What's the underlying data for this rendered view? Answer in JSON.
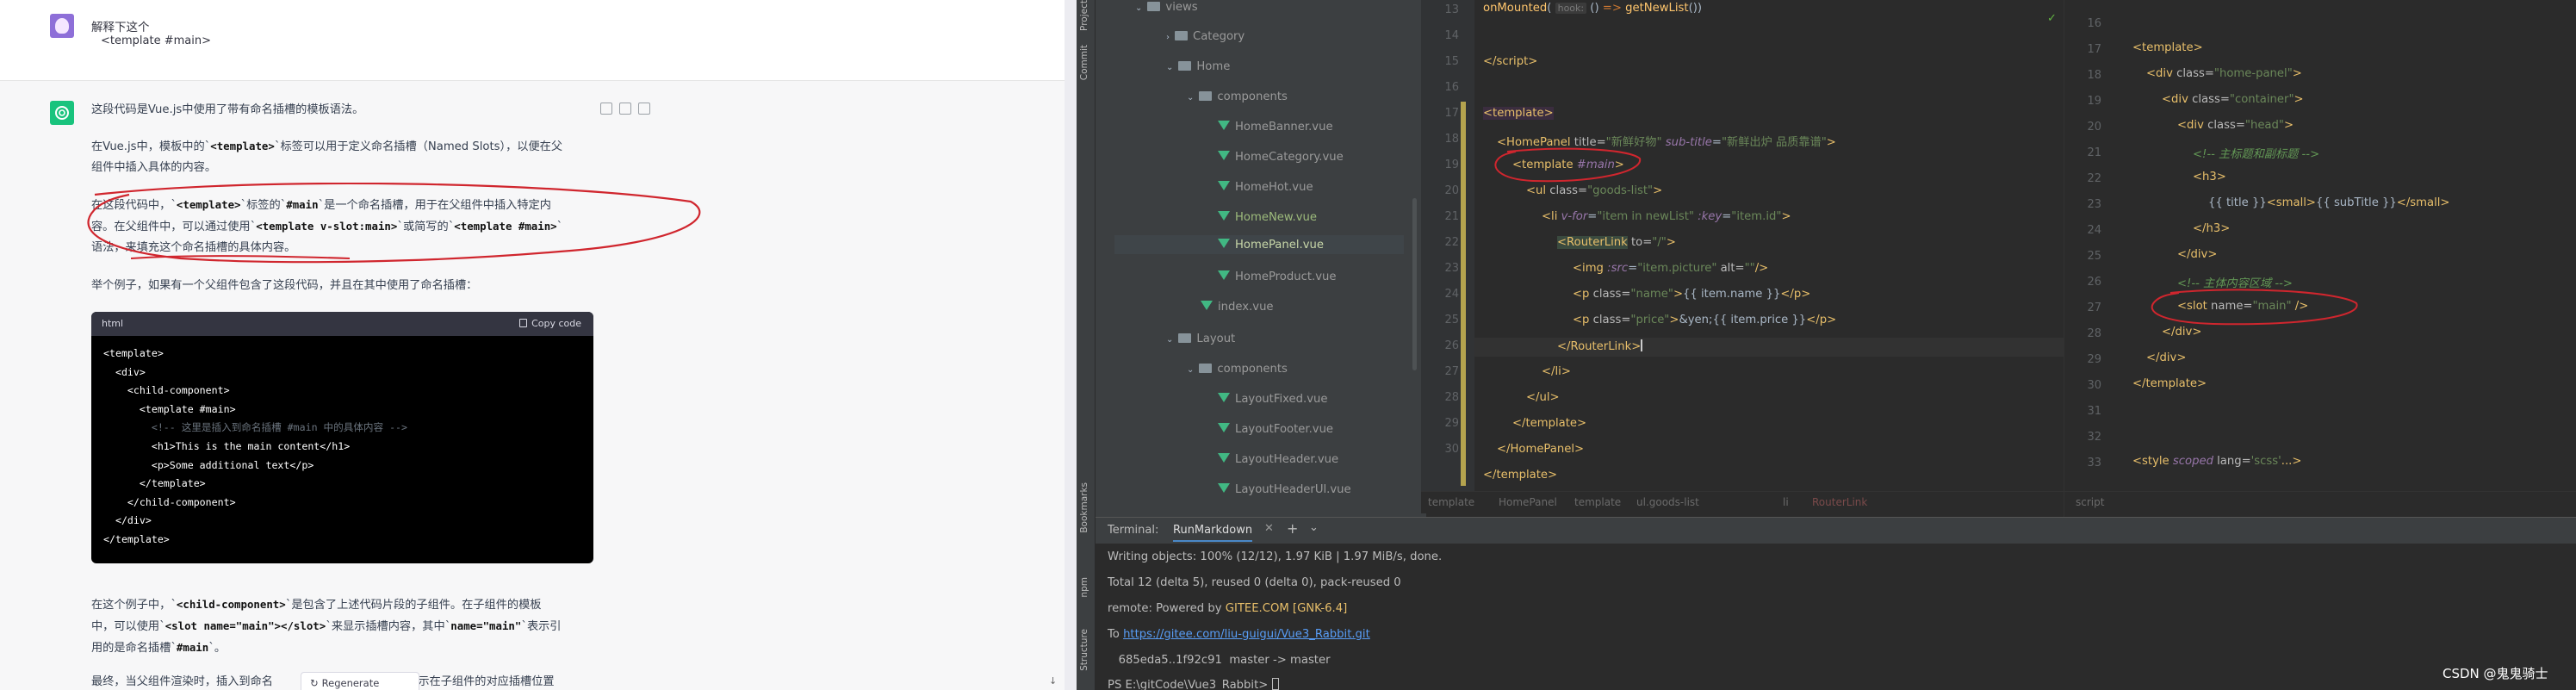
{
  "chat": {
    "user_message": {
      "line1": "解释下这个",
      "line2": "<template #main>"
    },
    "assistant": {
      "p1": "这段代码是Vue.js中使用了带有命名插槽的模板语法。",
      "p2_a": "在Vue.js中，模板中的",
      "p2_code1": "<template>",
      "p2_b": "标签可以用于定义命名插槽（Named Slots），以便在父",
      "p2_c": "组件中插入具体的内容。",
      "p3_a": "在这段代码中，",
      "p3_code1": "<template>",
      "p3_b": "标签的",
      "p3_code2": "#main",
      "p3_c": "是一个命名插槽，用于在父组件中插入特定内",
      "p3_d": "容。在父组件中，可以通过使用",
      "p3_code3": "<template v-slot:main>",
      "p3_e": "或简写的",
      "p3_code4": "<template #main>",
      "p3_f": "语法，来填充这个命名插槽的具体内容。",
      "p4": "举个例子，如果有一个父组件包含了这段代码，并且在其中使用了命名插槽：",
      "p5_a": "在这个例子中，",
      "p5_code1": "<child-component>",
      "p5_b": "是包含了上述代码片段的子组件。在子组件的模板",
      "p5_c": "中，可以使用",
      "p5_code2": "<slot name=\"main\"></slot>",
      "p5_d": "来显示插槽内容，其中",
      "p5_code3": "name=\"main\"",
      "p5_e": "表示引",
      "p5_f": "用的是命名插槽",
      "p5_code4": "#main",
      "p5_g": "。",
      "p6": "最终，当父组件渲染时，插入到命名",
      "p6_tail": "会显示在子组件的对应插槽位置"
    },
    "code_block": {
      "lang": "html",
      "copy_label": "Copy code",
      "lines": [
        "<template>",
        "  <div>",
        "    <child-component>",
        "      <template #main>",
        "        <!-- 这里是插入到命名插槽 #main 中的具体内容 -->",
        "        <h1>This is the main content</h1>",
        "        <p>Some additional text</p>",
        "      </template>",
        "    </child-component>",
        "  </div>",
        "</template>"
      ]
    },
    "regenerate_label": "Regenerate response"
  },
  "ide": {
    "side_tabs": {
      "project": "Project",
      "commit": "Commit",
      "bookmarks": "Bookmarks",
      "npm": "npm",
      "structure": "Structure"
    },
    "tree": [
      {
        "label": "views",
        "type": "folder",
        "arrow": "⌄"
      },
      {
        "label": "Category",
        "type": "folder",
        "arrow": "›"
      },
      {
        "label": "Home",
        "type": "folder",
        "arrow": "⌄"
      },
      {
        "label": "components",
        "type": "folder",
        "arrow": "⌄"
      },
      {
        "label": "HomeBanner.vue",
        "type": "vue"
      },
      {
        "label": "HomeCategory.vue",
        "type": "vue"
      },
      {
        "label": "HomeHot.vue",
        "type": "vue"
      },
      {
        "label": "HomeNew.vue",
        "type": "vue"
      },
      {
        "label": "HomePanel.vue",
        "type": "vue"
      },
      {
        "label": "HomeProduct.vue",
        "type": "vue"
      },
      {
        "label": "index.vue",
        "type": "vue"
      },
      {
        "label": "Layout",
        "type": "folder",
        "arrow": "⌄"
      },
      {
        "label": "components",
        "type": "folder",
        "arrow": "⌄"
      },
      {
        "label": "LayoutFixed.vue",
        "type": "vue"
      },
      {
        "label": "LayoutFooter.vue",
        "type": "vue"
      },
      {
        "label": "LayoutHeader.vue",
        "type": "vue"
      },
      {
        "label": "LayoutHeaderUl.vue",
        "type": "vue"
      }
    ],
    "editor1": {
      "line_numbers": [
        "13",
        "14",
        "15",
        "16",
        "17",
        "18",
        "19",
        "20",
        "21",
        "22",
        "23",
        "24",
        "25",
        "26",
        "27",
        "28",
        "29",
        "30"
      ],
      "hook_hint": "hook:",
      "breadcrumb": [
        "template",
        "HomePanel",
        "template",
        "ul.goods-list",
        "li",
        "RouterLink"
      ]
    },
    "editor2": {
      "line_numbers": [
        "16",
        "17",
        "18",
        "19",
        "20",
        "21",
        "22",
        "23",
        "24",
        "25",
        "26",
        "27",
        "28",
        "29",
        "30",
        "31",
        "32",
        "33"
      ],
      "comment1": "<!-- 主标题和副标题 -->",
      "comment2": "<!-- 主体内容区域 -->",
      "breadcrumb": [
        "script"
      ]
    },
    "terminal": {
      "label": "Terminal:",
      "tab": "RunMarkdown",
      "lines": [
        "Writing objects: 100% (12/12), 1.97 KiB | 1.97 MiB/s, done.",
        "Total 12 (delta 5), reused 0 (delta 0), pack-reused 0",
        "remote: Powered by ",
        "To ",
        "   685eda5..1f92c91  master -> master",
        "PS E:\\gitCode\\Vue3_Rabbit> "
      ],
      "gitee": "GITEE.COM",
      "gnk": "[GNK-6.4]",
      "url": "https://gitee.com/liu-guigui/Vue3_Rabbit.git"
    }
  },
  "watermark": "CSDN @鬼鬼骑士",
  "colors": {
    "chat_bg": "#f7f7f8",
    "ide_bg": "#2b2b2b",
    "annotation": "#d0262e",
    "gpt_green": "#19c37d"
  }
}
